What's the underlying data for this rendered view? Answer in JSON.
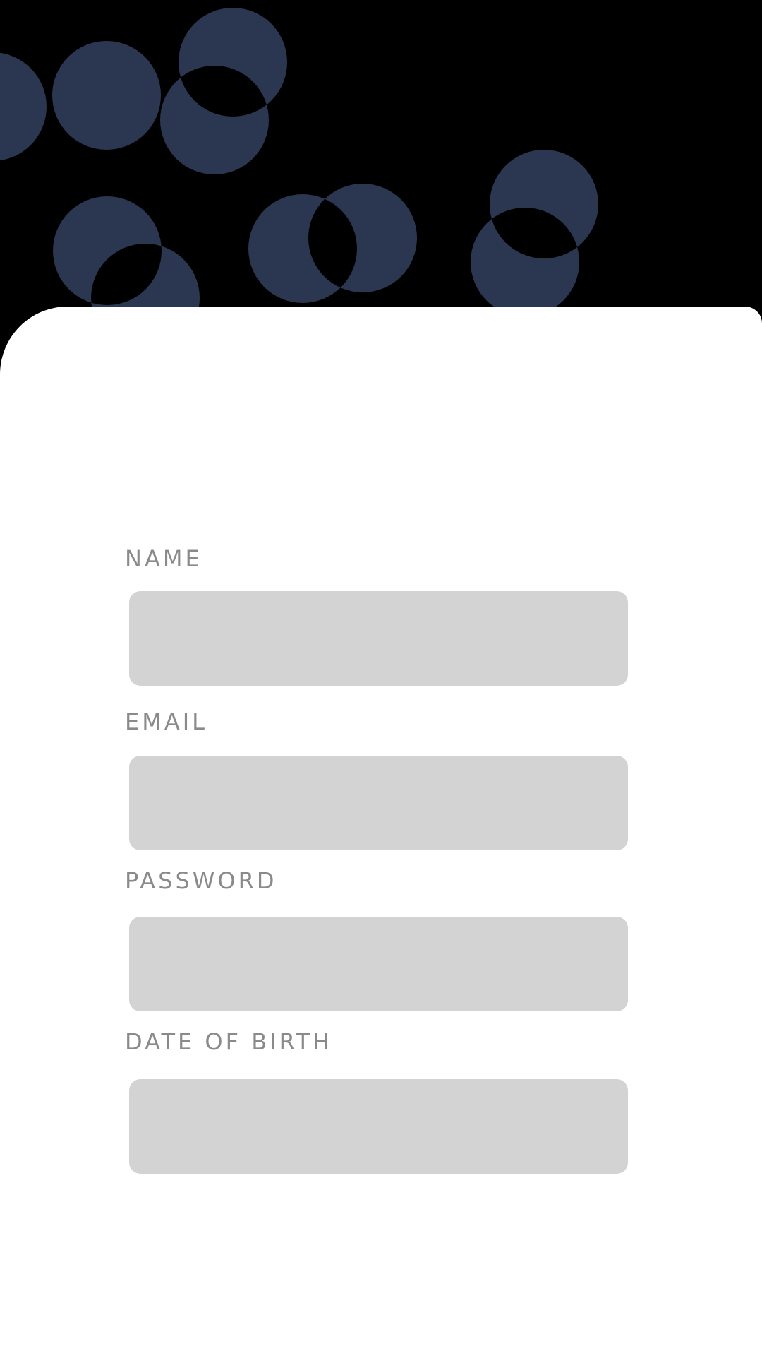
{
  "theme": {
    "background": "#000000",
    "bubble_color": "#2b3750",
    "card_color": "#ffffff",
    "label_color": "#8a8a8a",
    "input_fill": "#d3d3d3"
  },
  "form": {
    "fields": [
      {
        "label": "NAME",
        "value": "",
        "placeholder": ""
      },
      {
        "label": "EMAIL",
        "value": "",
        "placeholder": ""
      },
      {
        "label": "PASSWORD",
        "value": "",
        "placeholder": ""
      },
      {
        "label": "DATE OF BIRTH",
        "value": "",
        "placeholder": ""
      }
    ]
  }
}
